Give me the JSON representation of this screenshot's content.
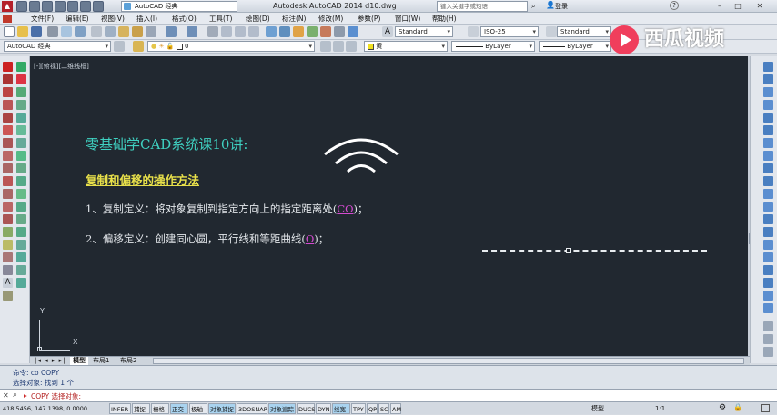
{
  "titlebar": {
    "workspace": "AutoCAD 经典",
    "title": "Autodesk AutoCAD 2014    d10.dwg",
    "search_placeholder": "键入关键字或短语",
    "login": "登录"
  },
  "menu": [
    "文件(F)",
    "编辑(E)",
    "视图(V)",
    "插入(I)",
    "格式(O)",
    "工具(T)",
    "绘图(D)",
    "标注(N)",
    "修改(M)",
    "参数(P)",
    "窗口(W)",
    "帮助(H)"
  ],
  "toolbar": {
    "text_style": "Standard",
    "dim_style": "ISO-25",
    "table_style": "Standard",
    "workspace2": "AutoCAD 经典",
    "layer": "0",
    "color": "黄",
    "linetype": "ByLayer",
    "lineweight": "ByLayer"
  },
  "viewport": {
    "label": "[-][俯视][二维线框]",
    "heading": "零基础学CAD系统课10讲:",
    "subheading": "复制和偏移的操作方法",
    "line1_pre": "1、复制定义：将对象复制到指定方向上的指定距离处(",
    "line1_cmd": "CO",
    "line1_post": ")；",
    "line2_pre": "2、偏移定义：创建同心圆，平行线和等距曲线(",
    "line2_cmd": "O",
    "line2_post": ")；",
    "ucs_y": "Y",
    "ucs_x": "X"
  },
  "tabs": [
    "模型",
    "布局1",
    "布局2"
  ],
  "command": {
    "history1": "命令: co COPY",
    "history2": "选择对象: 找到 1 个",
    "prompt": "COPY 选择对象:"
  },
  "status": {
    "coords": "418.5456, 147.1398, 0.0000",
    "toggles": [
      "INFER",
      "捕捉",
      "栅格",
      "正交",
      "极轴",
      "对象捕捉",
      "3DOSNAP",
      "对象追踪",
      "DUCS",
      "DYN",
      "线宽",
      "TPY",
      "QP",
      "SC",
      "AM"
    ],
    "on": [
      "正交",
      "对象捕捉",
      "对象追踪",
      "线宽"
    ],
    "model": "模型",
    "scale": "1:1"
  },
  "watermark": "西瓜视频",
  "colors": {
    "heading": "#3fd1c1",
    "subheading": "#e8e04a",
    "cmd": "#d44bd0",
    "canvas": "#212830"
  }
}
